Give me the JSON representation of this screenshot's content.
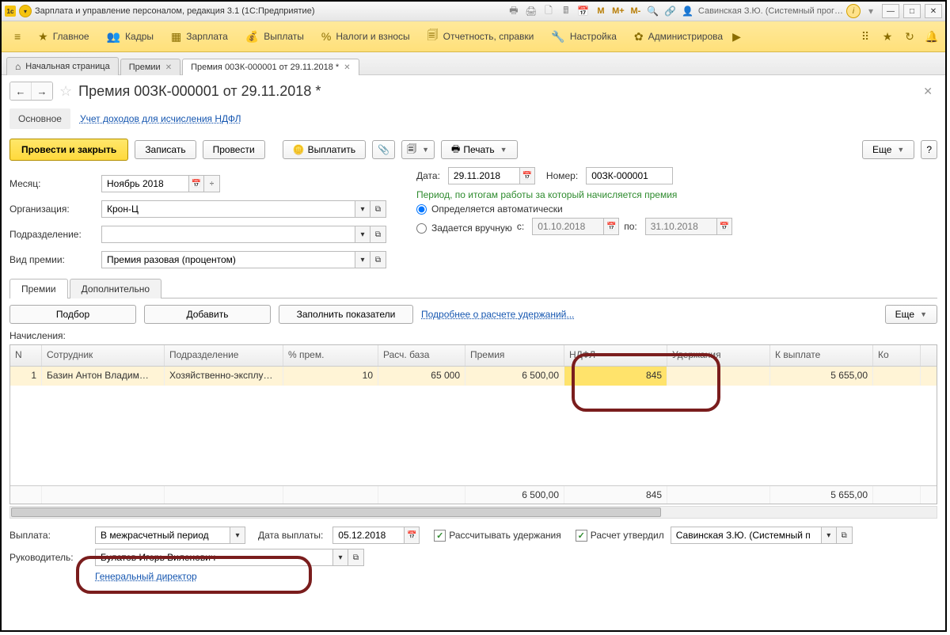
{
  "titlebar": {
    "app": "Зарплата и управление персоналом, редакция 3.1  (1С:Предприятие)",
    "user": "Савинская З.Ю. (Системный прог…"
  },
  "menu": {
    "items": [
      "Главное",
      "Кадры",
      "Зарплата",
      "Выплаты",
      "Налоги и взносы",
      "Отчетность, справки",
      "Настройка",
      "Администрирова"
    ]
  },
  "tabs": {
    "home": "Начальная страница",
    "t1": "Премии",
    "t2": "Премия 00ЗК-000001 от 29.11.2018 *"
  },
  "page": {
    "title": "Премия 00ЗК-000001 от 29.11.2018 *"
  },
  "subnav": {
    "main": "Основное",
    "link": "Учет доходов для исчисления НДФЛ"
  },
  "toolbar": {
    "post_close": "Провести и закрыть",
    "save": "Записать",
    "post": "Провести",
    "pay": "Выплатить",
    "print": "Печать",
    "more": "Еще"
  },
  "form": {
    "month_lbl": "Месяц:",
    "month": "Ноябрь 2018",
    "org_lbl": "Организация:",
    "org": "Крон-Ц",
    "dep_lbl": "Подразделение:",
    "dep": "",
    "type_lbl": "Вид премии:",
    "type": "Премия разовая (процентом)",
    "date_lbl": "Дата:",
    "date": "29.11.2018",
    "num_lbl": "Номер:",
    "num": "00ЗК-000001",
    "period_title": "Период, по итогам работы за который начисляется премия",
    "period_auto": "Определяется автоматически",
    "period_manual": "Задается вручную",
    "from_lbl": "с:",
    "from": "01.10.2018",
    "to_lbl": "по:",
    "to": "31.10.2018"
  },
  "tabs2": {
    "t1": "Премии",
    "t2": "Дополнительно"
  },
  "tblbar": {
    "pick": "Подбор",
    "add": "Добавить",
    "fill": "Заполнить показатели",
    "details": "Подробнее о расчете удержаний...",
    "more": "Еще"
  },
  "grid": {
    "section": "Начисления:",
    "headers": {
      "n": "N",
      "emp": "Сотрудник",
      "dep": "Подразделение",
      "pct": "% прем.",
      "base": "Расч. база",
      "prem": "Премия",
      "ndfl": "НДФЛ",
      "ded": "Удержания",
      "pay": "К выплате",
      "ko": "Ко"
    },
    "row": {
      "n": "1",
      "emp": "Базин Антон Владим…",
      "dep": "Хозяйственно-эксплу…",
      "pct": "10",
      "base": "65 000",
      "prem": "6 500,00",
      "ndfl": "845",
      "ded": "",
      "pay": "5 655,00"
    },
    "totals": {
      "prem": "6 500,00",
      "ndfl": "845",
      "pay": "5 655,00"
    }
  },
  "bottom": {
    "pay_lbl": "Выплата:",
    "pay_mode": "В межрасчетный период",
    "paydate_lbl": "Дата выплаты:",
    "paydate": "05.12.2018",
    "calc_ded": "Рассчитывать удержания",
    "approved": "Расчет утвердил",
    "approver": "Савинская З.Ю. (Системный п",
    "mgr_lbl": "Руководитель:",
    "mgr": "Булатов Игорь Виленович",
    "mgr_pos": "Генеральный директор"
  }
}
